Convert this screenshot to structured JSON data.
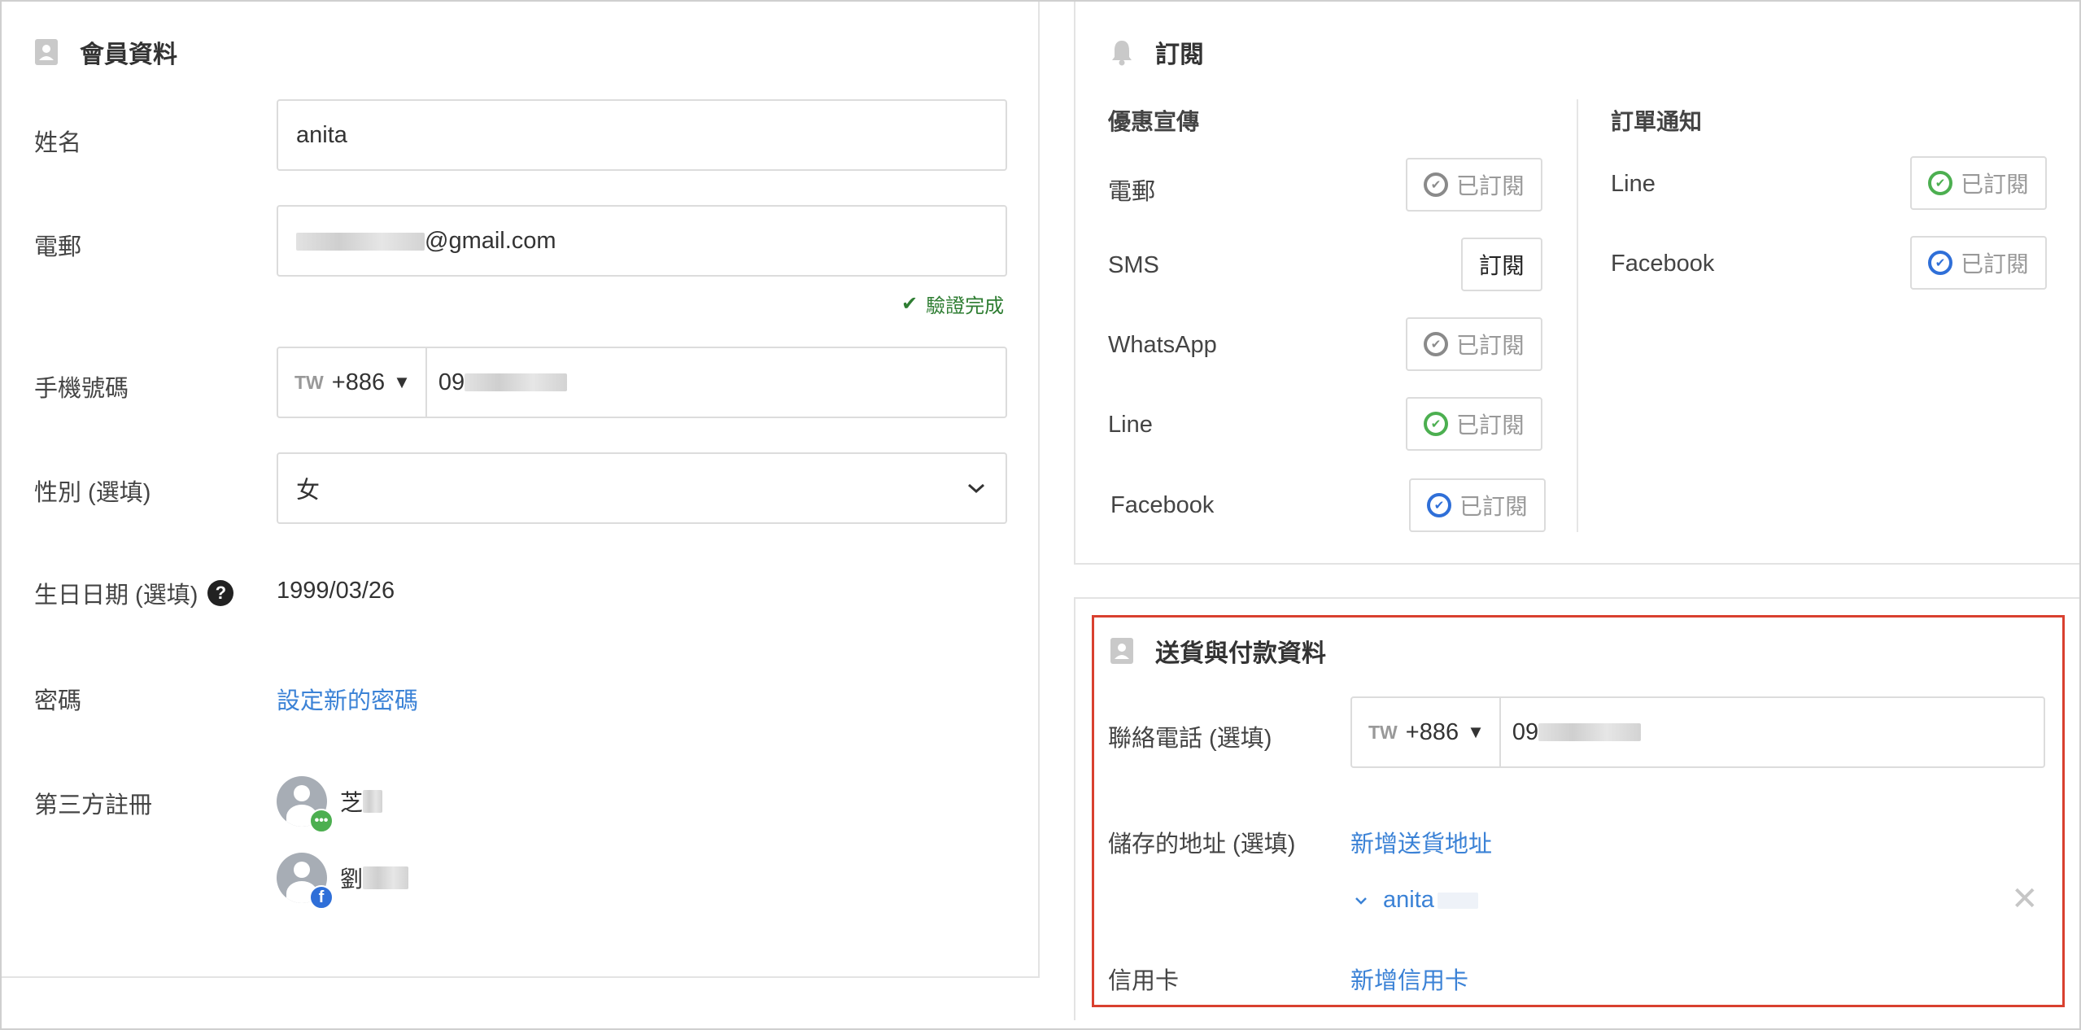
{
  "member": {
    "title": "會員資料",
    "name_label": "姓名",
    "name_value": "anita",
    "email_label": "電郵",
    "email_suffix": "@gmail.com",
    "verified_text": "驗證完成",
    "mobile_label": "手機號碼",
    "country_code": "TW",
    "dial_code": "+886",
    "mobile_prefix": "09",
    "gender_label": "性別 (選填)",
    "gender_value": "女",
    "birthday_label": "生日日期 (選填)",
    "birthday_value": "1999/03/26",
    "password_label": "密碼",
    "password_link": "設定新的密碼",
    "third_party_label": "第三方註冊",
    "third_party": [
      {
        "name": "芝",
        "provider": "line"
      },
      {
        "name": "劉",
        "provider": "facebook"
      }
    ]
  },
  "subscription": {
    "title": "訂閱",
    "promo_header": "優惠宣傳",
    "order_header": "訂單通知",
    "promo_items": [
      {
        "label": "電郵",
        "button": "已訂閱",
        "state": "subscribed",
        "icon_color": "#8a8a8a"
      },
      {
        "label": "SMS",
        "button": "訂閱",
        "state": "unsubscribed",
        "icon_color": ""
      },
      {
        "label": "WhatsApp",
        "button": "已訂閱",
        "state": "subscribed",
        "icon_color": "#8a8a8a"
      },
      {
        "label": "Line",
        "button": "已訂閱",
        "state": "subscribed",
        "icon_color": "#4caf50"
      },
      {
        "label": "Facebook",
        "button": "已訂閱",
        "state": "subscribed",
        "icon_color": "#2f6fd8"
      }
    ],
    "order_items": [
      {
        "label": "Line",
        "button": "已訂閱",
        "state": "subscribed",
        "icon_color": "#4caf50"
      },
      {
        "label": "Facebook",
        "button": "已訂閱",
        "state": "subscribed",
        "icon_color": "#2f6fd8"
      }
    ]
  },
  "shipping": {
    "title": "送貨與付款資料",
    "phone_label": "聯絡電話 (選填)",
    "country_code": "TW",
    "dial_code": "+886",
    "phone_prefix": "09",
    "address_label": "儲存的地址 (選填)",
    "add_address_link": "新增送貨地址",
    "saved_address_name": "anita",
    "credit_card_label": "信用卡",
    "add_card_link": "新增信用卡"
  },
  "colors": {
    "link": "#3b82d6",
    "highlight_border": "#d9402f",
    "verified": "#2e7d32",
    "line_green": "#4caf50",
    "facebook_blue": "#2f6fd8"
  }
}
